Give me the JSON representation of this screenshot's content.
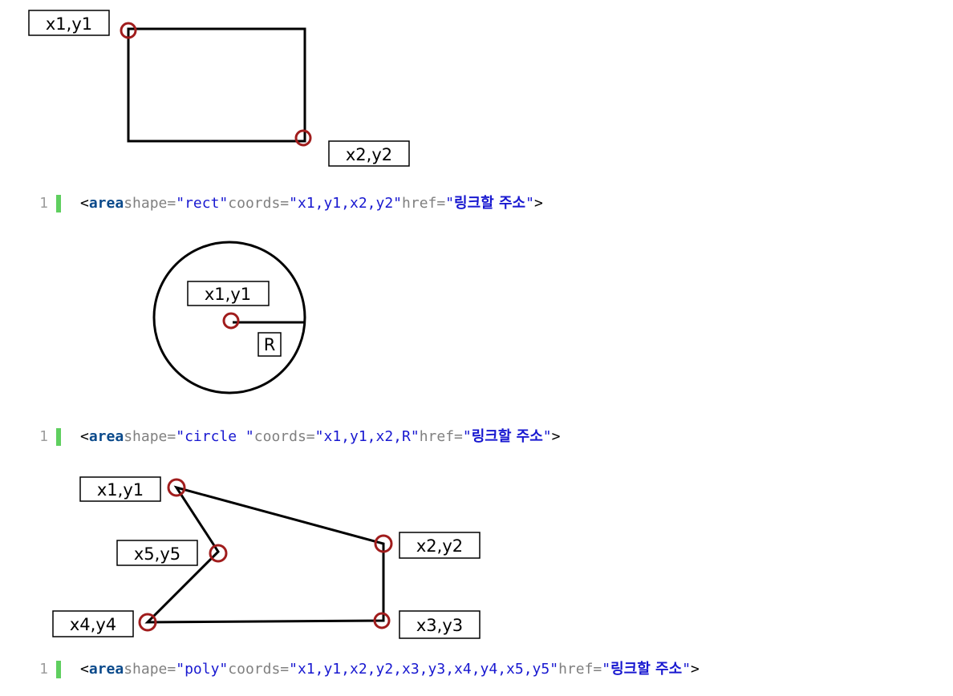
{
  "colors": {
    "marker": "#a01c1c",
    "line_number": "#9e9e9e",
    "gutter_bar": "#5fcf5f",
    "tag": "#0b4a8b",
    "attr": "#808080",
    "value": "#1818d0"
  },
  "rect_diagram": {
    "label_top_left": "x1,y1",
    "label_bottom_right": "x2,y2"
  },
  "circle_diagram": {
    "label_center": "x1,y1",
    "label_radius": "R"
  },
  "poly_diagram": {
    "labels": [
      "x1,y1",
      "x2,y2",
      "x3,y3",
      "x4,y4",
      "x5,y5"
    ]
  },
  "code_lines": [
    {
      "line_number": "1",
      "open": "<",
      "tag": "area",
      "shape_attr": " shape=",
      "shape_value": "\"rect\"",
      "coords_attr": " coords=",
      "coords_value": "\"x1,y1,x2,y2\"",
      "href_attr": " href=",
      "href_q1": "\"",
      "href_text": "링크할 주소",
      "href_q2": "\"",
      "close": ">"
    },
    {
      "line_number": "1",
      "open": "<",
      "tag": "area",
      "shape_attr": " shape=",
      "shape_value": "\"circle \"",
      "coords_attr": " coords=",
      "coords_value": "\"x1,y1,x2,R\"",
      "href_attr": " href=",
      "href_q1": "\"",
      "href_text": "링크할 주소",
      "href_q2": "\"",
      "close": ">"
    },
    {
      "line_number": "1",
      "open": "<",
      "tag": "area",
      "shape_attr": " shape=",
      "shape_value": "\"poly\"",
      "coords_attr": " coords=",
      "coords_value": "\"x1,y1,x2,y2,x3,y3,x4,y4,x5,y5\"",
      "href_attr": " href=",
      "href_q1": "\"",
      "href_text": "링크할 주소",
      "href_q2": "\"",
      "close": ">"
    }
  ]
}
